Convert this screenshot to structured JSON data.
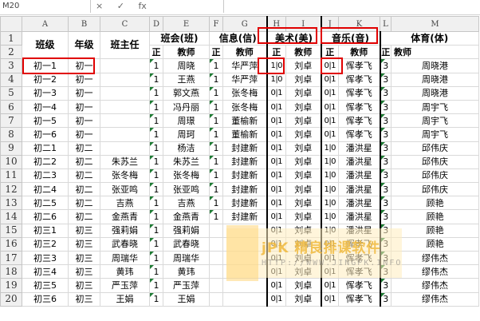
{
  "formula_bar": {
    "name_box": "M20",
    "cancel_icon": "×",
    "enter_icon": "✓",
    "fx_label": "fx"
  },
  "columns": [
    "A",
    "B",
    "C",
    "D",
    "E",
    "F",
    "G",
    "H",
    "I",
    "J",
    "K",
    "L",
    "M"
  ],
  "rows": [
    "1",
    "2",
    "3",
    "4",
    "5",
    "6",
    "7",
    "8",
    "9",
    "10",
    "11",
    "12",
    "13",
    "14",
    "15",
    "16",
    "17",
    "18",
    "19",
    "20"
  ],
  "header1": {
    "class": "班级",
    "grade": "年级",
    "head_teacher": "班主任",
    "subj1": "班会(班)",
    "subj2": "信息(信)",
    "subj3": "美术(美)",
    "subj4": "音乐(音)",
    "subj5": "体育(体)"
  },
  "header2": {
    "zheng": "正",
    "jiaoshi": "教师"
  },
  "data_rows": [
    {
      "cls": "初一1",
      "grade": "初一",
      "ht": "",
      "d": "1",
      "e": "周晓",
      "f": "1",
      "g": "华严萍",
      "h": "1|0",
      "i": "刘卓",
      "j": "0|1",
      "k": "恽孝飞",
      "l": "3",
      "m": "周晓港"
    },
    {
      "cls": "初一2",
      "grade": "初一",
      "ht": "",
      "d": "1",
      "e": "王燕",
      "f": "1",
      "g": "华严萍",
      "h": "1|0",
      "i": "刘卓",
      "j": "0|1",
      "k": "恽孝飞",
      "l": "3",
      "m": "周晓港"
    },
    {
      "cls": "初一3",
      "grade": "初一",
      "ht": "",
      "d": "1",
      "e": "郭文燕",
      "f": "1",
      "g": "张冬梅",
      "h": "0|1",
      "i": "刘卓",
      "j": "0|1",
      "k": "恽孝飞",
      "l": "3",
      "m": "周晓港"
    },
    {
      "cls": "初一4",
      "grade": "初一",
      "ht": "",
      "d": "1",
      "e": "冯丹丽",
      "f": "1",
      "g": "张冬梅",
      "h": "0|1",
      "i": "刘卓",
      "j": "0|1",
      "k": "恽孝飞",
      "l": "3",
      "m": "周宇飞"
    },
    {
      "cls": "初一5",
      "grade": "初一",
      "ht": "",
      "d": "1",
      "e": "周璟",
      "f": "1",
      "g": "董榆新",
      "h": "0|1",
      "i": "刘卓",
      "j": "0|1",
      "k": "恽孝飞",
      "l": "3",
      "m": "周宇飞"
    },
    {
      "cls": "初一6",
      "grade": "初一",
      "ht": "",
      "d": "1",
      "e": "周珂",
      "f": "1",
      "g": "董榆新",
      "h": "0|1",
      "i": "刘卓",
      "j": "0|1",
      "k": "恽孝飞",
      "l": "3",
      "m": "周宇飞"
    },
    {
      "cls": "初二1",
      "grade": "初二",
      "ht": "",
      "d": "1",
      "e": "杨洁",
      "f": "1",
      "g": "封建新",
      "h": "0|1",
      "i": "刘卓",
      "j": "1|0",
      "k": "潘洪星",
      "l": "3",
      "m": "邱伟庆"
    },
    {
      "cls": "初二2",
      "grade": "初二",
      "ht": "朱苏兰",
      "d": "1",
      "e": "朱苏兰",
      "f": "1",
      "g": "封建新",
      "h": "0|1",
      "i": "刘卓",
      "j": "1|0",
      "k": "潘洪星",
      "l": "3",
      "m": "邱伟庆"
    },
    {
      "cls": "初二3",
      "grade": "初二",
      "ht": "张冬梅",
      "d": "1",
      "e": "张冬梅",
      "f": "1",
      "g": "封建新",
      "h": "0|1",
      "i": "刘卓",
      "j": "1|0",
      "k": "潘洪星",
      "l": "3",
      "m": "邱伟庆"
    },
    {
      "cls": "初二4",
      "grade": "初二",
      "ht": "张亚鸣",
      "d": "1",
      "e": "张亚鸣",
      "f": "1",
      "g": "封建新",
      "h": "0|1",
      "i": "刘卓",
      "j": "1|0",
      "k": "潘洪星",
      "l": "3",
      "m": "邱伟庆"
    },
    {
      "cls": "初二5",
      "grade": "初二",
      "ht": "吉燕",
      "d": "1",
      "e": "吉燕",
      "f": "1",
      "g": "封建新",
      "h": "0|1",
      "i": "刘卓",
      "j": "1|0",
      "k": "潘洪星",
      "l": "3",
      "m": "顾艳"
    },
    {
      "cls": "初二6",
      "grade": "初二",
      "ht": "金燕青",
      "d": "1",
      "e": "金燕青",
      "f": "1",
      "g": "封建新",
      "h": "0|1",
      "i": "刘卓",
      "j": "1|0",
      "k": "潘洪星",
      "l": "3",
      "m": "顾艳"
    },
    {
      "cls": "初三1",
      "grade": "初三",
      "ht": "强莉娟",
      "d": "1",
      "e": "强莉娟",
      "f": "",
      "g": "",
      "h": "0|1",
      "i": "刘卓",
      "j": "1|0",
      "k": "潘洪星",
      "l": "3",
      "m": "顾艳"
    },
    {
      "cls": "初三2",
      "grade": "初三",
      "ht": "武春晓",
      "d": "1",
      "e": "武春晓",
      "f": "",
      "g": "",
      "h": "0|1",
      "i": "刘卓",
      "j": "0|1",
      "k": "恽孝飞",
      "l": "3",
      "m": "顾艳"
    },
    {
      "cls": "初三3",
      "grade": "初三",
      "ht": "周瑞华",
      "d": "1",
      "e": "周瑞华",
      "f": "",
      "g": "",
      "h": "0|1",
      "i": "刘卓",
      "j": "0|1",
      "k": "恽孝飞",
      "l": "3",
      "m": "缪伟杰"
    },
    {
      "cls": "初三4",
      "grade": "初三",
      "ht": "黄玮",
      "d": "1",
      "e": "黄玮",
      "f": "",
      "g": "",
      "h": "0|1",
      "i": "刘卓",
      "j": "0|1",
      "k": "恽孝飞",
      "l": "3",
      "m": "缪伟杰"
    },
    {
      "cls": "初三5",
      "grade": "初三",
      "ht": "严玉萍",
      "d": "1",
      "e": "严玉萍",
      "f": "",
      "g": "",
      "h": "0|1",
      "i": "刘卓",
      "j": "0|1",
      "k": "恽孝飞",
      "l": "3",
      "m": "缪伟杰"
    },
    {
      "cls": "初三6",
      "grade": "初三",
      "ht": "王娟",
      "d": "1",
      "e": "王娟",
      "f": "",
      "g": "",
      "h": "0|1",
      "i": "刘卓",
      "j": "0|1",
      "k": "恽孝飞",
      "l": "3",
      "m": "缪伟杰"
    }
  ],
  "watermark": {
    "title": "jPK 精良排课软件",
    "url": "HTTP://WWW.JINGPK.INFO"
  },
  "colors": {
    "highlight_border": "#e00000",
    "header_bg": "#f0f0f0",
    "grid": "#d9d9d9",
    "triangle": "#1e7b34"
  }
}
